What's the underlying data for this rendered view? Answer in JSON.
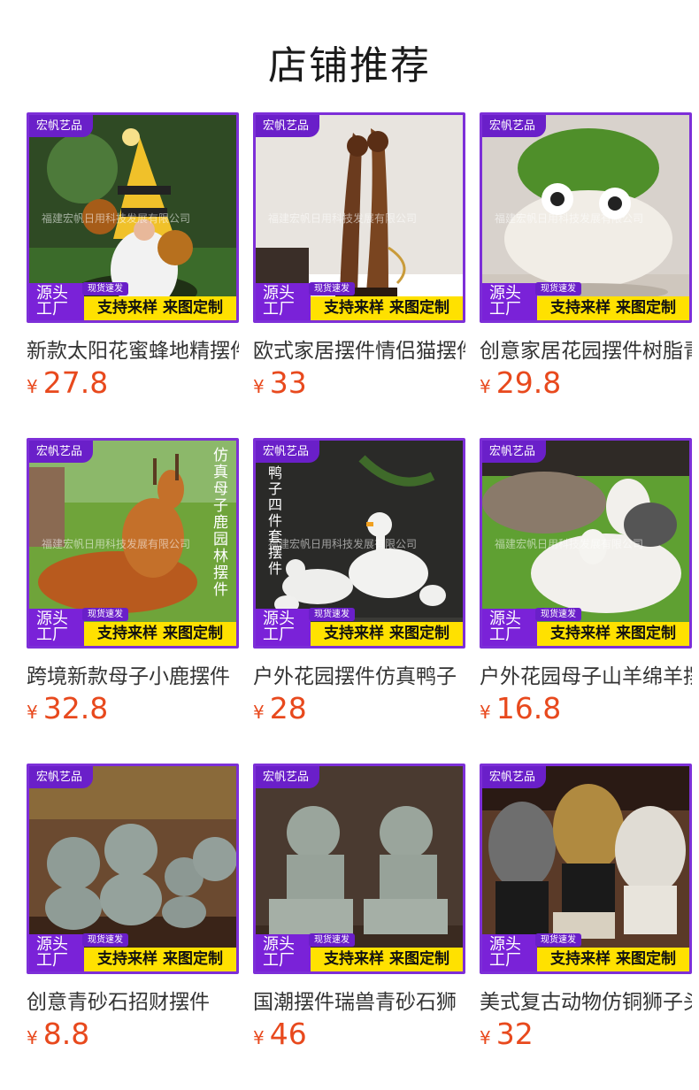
{
  "page_title": "店铺推荐",
  "badges": {
    "shop": "宏帆艺品",
    "source_line1": "源头",
    "source_line2": "工厂",
    "stock": "现货速发",
    "custom": "支持来样 来图定制"
  },
  "watermark": "福建宏帆日用科技发展有限公司",
  "currency": "¥",
  "products": [
    {
      "name": "新款太阳花蜜蜂地精摆件",
      "price": "27.8",
      "theme": "gnome"
    },
    {
      "name": "欧式家居摆件情侣猫摆件",
      "price": "33",
      "theme": "cats"
    },
    {
      "name": "创意家居花园摆件树脂青蛙",
      "price": "29.8",
      "theme": "frogs"
    },
    {
      "name": "跨境新款母子小鹿摆件",
      "price": "32.8",
      "theme": "deer",
      "side_text": "仿真母子鹿园林摆件"
    },
    {
      "name": "户外花园摆件仿真鸭子",
      "price": "28",
      "theme": "ducks",
      "side_text": "鸭子四件套摆件"
    },
    {
      "name": "户外花园母子山羊绵羊摆件",
      "price": "16.8",
      "theme": "sheep"
    },
    {
      "name": "创意青砂石招财摆件",
      "price": "8.8",
      "theme": "figures"
    },
    {
      "name": "国潮摆件瑞兽青砂石狮",
      "price": "46",
      "theme": "lions"
    },
    {
      "name": "美式复古动物仿铜狮子头",
      "price": "32",
      "theme": "lionheads"
    }
  ]
}
